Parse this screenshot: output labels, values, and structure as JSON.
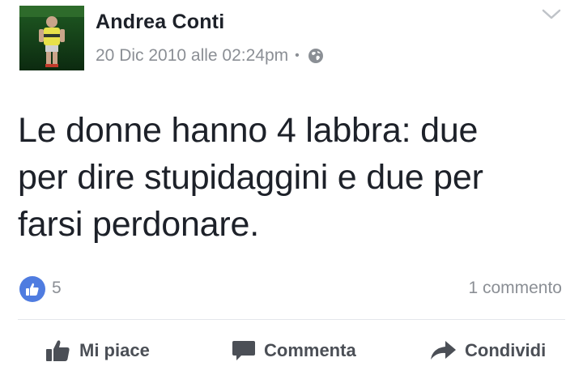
{
  "post": {
    "author": "Andrea Conti",
    "timestamp": "20 Dic 2010 alle 02:24pm",
    "separator": "•",
    "privacy_icon": "globe-icon",
    "menu_icon": "chevron-down-icon",
    "message_lines": [
      "Le donne hanno 4 labbra: due",
      "per dire stupidaggini e due per",
      "farsi perdonare."
    ]
  },
  "stats": {
    "like_icon": "thumbs-up-icon",
    "likes": "5",
    "comments": "1 commento"
  },
  "actions": {
    "like": "Mi piace",
    "comment": "Commenta",
    "share": "Condividi"
  },
  "colors": {
    "accent_blue": "#4f7ce0",
    "text": "#1d2129",
    "muted": "#8b8f95",
    "action_text": "#4b4f56"
  }
}
